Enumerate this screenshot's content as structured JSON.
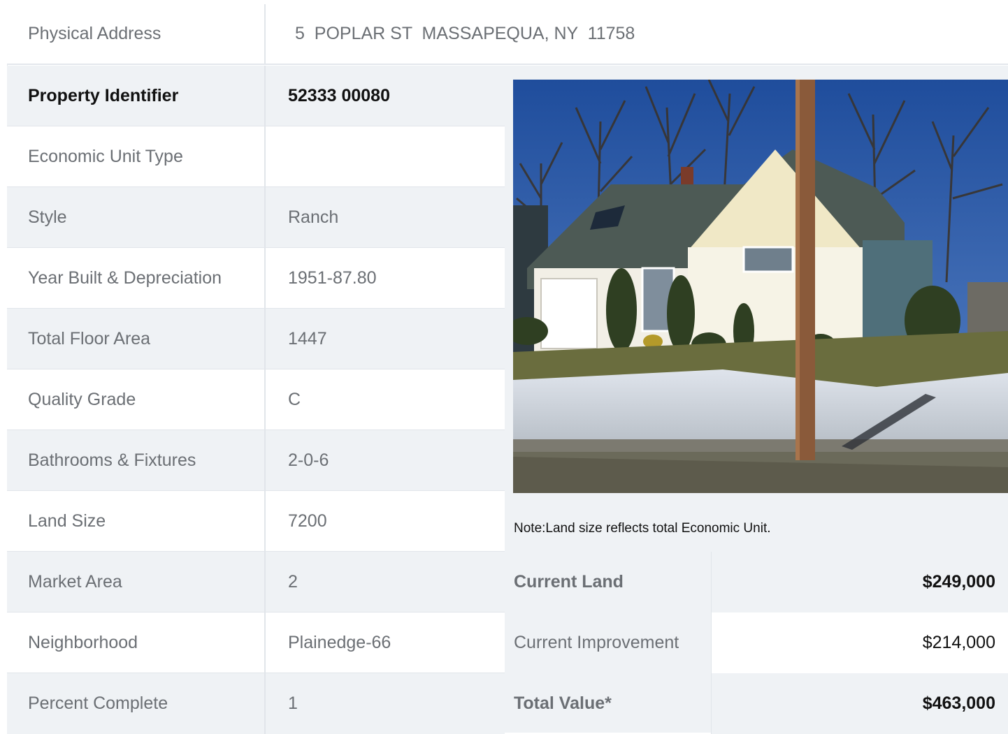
{
  "address": {
    "label": "Physical Address",
    "value": "5  POPLAR ST  MASSAPEQUA, NY  11758"
  },
  "rows": [
    {
      "label": "Property Identifier",
      "value": "52333  00080"
    },
    {
      "label": "Economic Unit Type",
      "value": ""
    },
    {
      "label": "Style",
      "value": "Ranch"
    },
    {
      "label": "Year Built & Depreciation",
      "value": "1951-87.80"
    },
    {
      "label": "Total Floor Area",
      "value": "1447"
    },
    {
      "label": "Quality Grade",
      "value": "C"
    },
    {
      "label": "Bathrooms & Fixtures",
      "value": "2-0-6"
    },
    {
      "label": "Land Size",
      "value": "7200"
    },
    {
      "label": "Market Area",
      "value": "2"
    },
    {
      "label": "Neighborhood",
      "value": "Plainedge-66"
    },
    {
      "label": "Percent Complete",
      "value": "1"
    }
  ],
  "note": "Note:Land size reflects total Economic Unit.",
  "valuation": {
    "current_land": {
      "label": "Current Land",
      "amount": "$249,000"
    },
    "current_improvement": {
      "label": "Current Improvement",
      "amount": "$214,000"
    },
    "total_value": {
      "label": "Total Value*",
      "amount": "$463,000"
    }
  }
}
